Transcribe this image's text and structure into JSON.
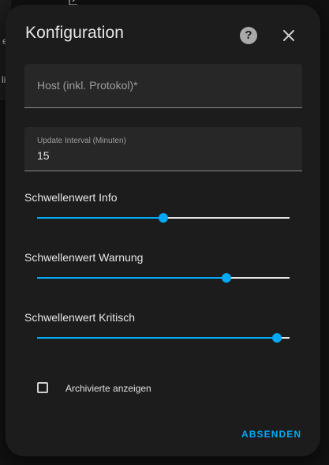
{
  "background": {
    "glyph_top": "e",
    "glyph_bottom": "li"
  },
  "dialog": {
    "title": "Konfiguration",
    "help_icon": "question-circle-icon",
    "close_icon": "close-icon"
  },
  "fields": {
    "host": {
      "placeholder": "Host (inkl. Protokol)*"
    },
    "update_interval": {
      "label": "Update Interval (Minuten)",
      "value": "15"
    }
  },
  "sliders": [
    {
      "label": "Schwellenwert Info",
      "fraction": 0.5
    },
    {
      "label": "Schwellenwert Warnung",
      "fraction": 0.75
    },
    {
      "label": "Schwellenwert Kritisch",
      "fraction": 0.95
    }
  ],
  "checkbox": {
    "label": "Archivierte anzeigen",
    "checked": false
  },
  "submit": {
    "label": "ABSENDEN"
  },
  "colors": {
    "accent": "#03a9f4",
    "surface": "#1c1c1c",
    "field_bg": "#272727"
  }
}
